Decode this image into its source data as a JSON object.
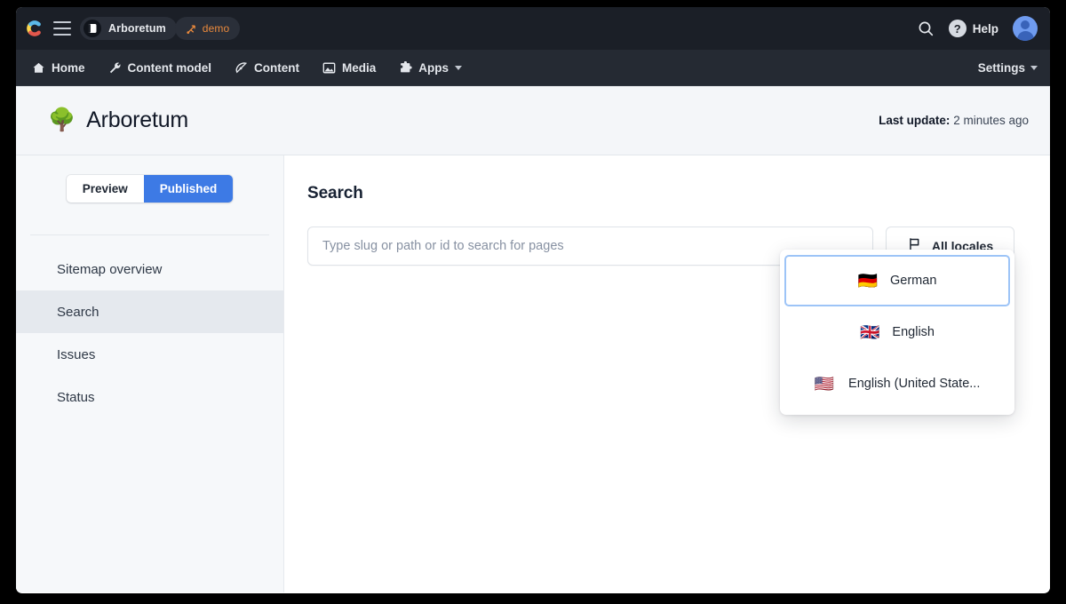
{
  "topbar": {
    "logo_name": "contentful-logo",
    "menu_icon": "hamburger-menu-icon",
    "space_icon": "space-book-icon",
    "space_name": "Arboretum",
    "env_icon": "branch-icon",
    "env_name": "demo",
    "search_icon": "search-icon",
    "help_glyph": "?",
    "help_label": "Help",
    "avatar_name": "user-avatar"
  },
  "nav": {
    "items": [
      {
        "label": "Home",
        "icon": "home-icon"
      },
      {
        "label": "Content model",
        "icon": "wrench-icon"
      },
      {
        "label": "Content",
        "icon": "pen-nib-icon"
      },
      {
        "label": "Media",
        "icon": "image-icon"
      },
      {
        "label": "Apps",
        "icon": "puzzle-piece-icon",
        "caret": true
      }
    ],
    "settings_label": "Settings"
  },
  "app_header": {
    "emoji": "🌳",
    "title": "Arboretum",
    "last_update_label": "Last update:",
    "last_update_value": "2 minutes ago"
  },
  "sidebar": {
    "toggle": {
      "preview_label": "Preview",
      "published_label": "Published",
      "selected": "Published"
    },
    "items": [
      {
        "label": "Sitemap overview",
        "active": false
      },
      {
        "label": "Search",
        "active": true
      },
      {
        "label": "Issues",
        "active": false
      },
      {
        "label": "Status",
        "active": false
      }
    ]
  },
  "main": {
    "title": "Search",
    "search": {
      "value": "",
      "placeholder": "Type slug or path or id to search for pages"
    },
    "locales_button": {
      "label": "All locales",
      "icon": "flag-icon"
    },
    "locale_menu": {
      "items": [
        {
          "label": "German",
          "flag": "🇩🇪",
          "focused": true
        },
        {
          "label": "English",
          "flag": "🇬🇧",
          "focused": false
        },
        {
          "label": "English (United State...",
          "flag": "🇺🇸",
          "focused": false
        }
      ]
    }
  },
  "colors": {
    "accent_blue": "#3d7ae5",
    "focus_ring": "#9dc4f7",
    "chrome_dark": "#1b1f27",
    "nav_dark": "#252a33",
    "env_orange": "#eb8a3c",
    "sidebar_bg": "#f6f8fa",
    "header_band": "#f4f6f9"
  }
}
